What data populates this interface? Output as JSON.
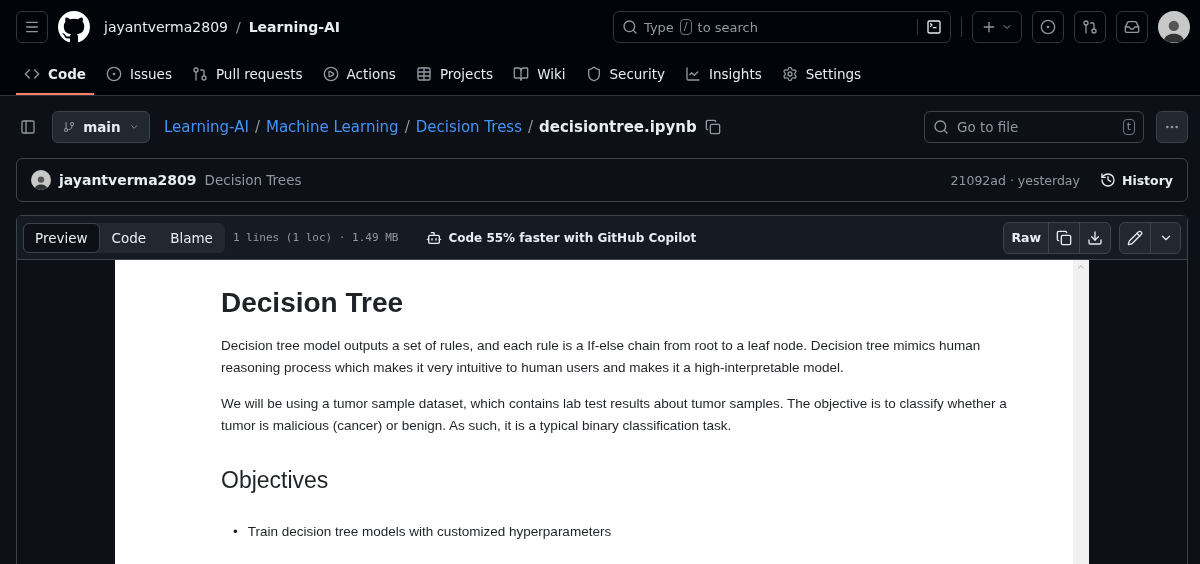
{
  "header": {
    "owner": "jayantverma2809",
    "separator": "/",
    "repo": "Learning-AI",
    "search": {
      "placeholder_parts": [
        "Type",
        "/",
        "to search"
      ]
    }
  },
  "repo_nav": [
    {
      "label": "Code",
      "selected": true
    },
    {
      "label": "Issues",
      "selected": false
    },
    {
      "label": "Pull requests",
      "selected": false
    },
    {
      "label": "Actions",
      "selected": false
    },
    {
      "label": "Projects",
      "selected": false
    },
    {
      "label": "Wiki",
      "selected": false
    },
    {
      "label": "Security",
      "selected": false
    },
    {
      "label": "Insights",
      "selected": false
    },
    {
      "label": "Settings",
      "selected": false
    }
  ],
  "file_bar": {
    "branch": "main",
    "breadcrumb": [
      {
        "label": "Learning-AI",
        "kind": "link"
      },
      {
        "label": "Machine Learning",
        "kind": "link"
      },
      {
        "label": "Decision Tress",
        "kind": "link"
      },
      {
        "label": "decisiontree.ipynb",
        "kind": "current"
      }
    ],
    "separator": "/",
    "go_to_file": {
      "placeholder": "Go to file",
      "shortcut": "t"
    }
  },
  "commit": {
    "author": "jayantverma2809",
    "message": "Decision Trees",
    "meta": "21092ad · yesterday",
    "history": "History"
  },
  "file_header": {
    "views": [
      {
        "label": "Preview",
        "selected": true
      },
      {
        "label": "Code",
        "selected": false
      },
      {
        "label": "Blame",
        "selected": false
      }
    ],
    "info": "1 lines (1 loc) · 1.49 MB",
    "copilot": "Code 55% faster with GitHub Copilot",
    "raw": "Raw"
  },
  "notebook": {
    "title": "Decision Tree",
    "paragraphs": [
      "Decision tree model outputs a set of rules, and each rule is a If-else chain from root to a leaf node. Decision tree mimics human reasoning process which makes it very intuitive to human users and makes it a high-interpretable model.",
      "We will be using a tumor sample dataset, which contains lab test results about tumor samples. The objective is to classify whether a tumor is malicious (cancer) or benign. As such, it is a typical binary classification task."
    ],
    "subtitle": "Objectives",
    "bullets": [
      {
        "marker": "•",
        "text": "Train decision tree models with customized hyperparameters"
      }
    ]
  }
}
